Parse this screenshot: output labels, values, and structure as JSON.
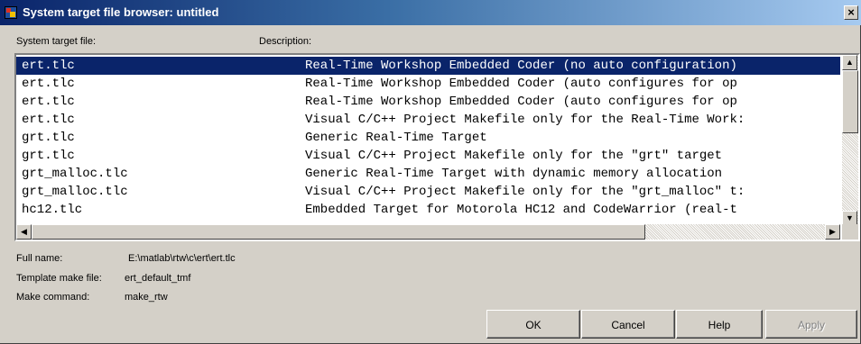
{
  "window": {
    "title": "System target file browser: untitled",
    "close_glyph": "×"
  },
  "columns": {
    "file_header": "System target file:",
    "desc_header": "Description:"
  },
  "list": {
    "selected_index": 0,
    "rows": [
      {
        "file": "ert.tlc",
        "description": "Real-Time Workshop Embedded Coder (no auto configuration)"
      },
      {
        "file": "ert.tlc",
        "description": "Real-Time Workshop Embedded Coder (auto configures for op"
      },
      {
        "file": "ert.tlc",
        "description": "Real-Time Workshop Embedded Coder (auto configures for op"
      },
      {
        "file": "ert.tlc",
        "description": "Visual C/C++ Project Makefile only for the Real-Time Work:"
      },
      {
        "file": "grt.tlc",
        "description": "Generic Real-Time Target"
      },
      {
        "file": "grt.tlc",
        "description": "Visual C/C++ Project Makefile only for the \"grt\" target"
      },
      {
        "file": "grt_malloc.tlc",
        "description": "Generic Real-Time Target with dynamic memory allocation"
      },
      {
        "file": "grt_malloc.tlc",
        "description": "Visual C/C++ Project Makefile only for the \"grt_malloc\" t:"
      },
      {
        "file": "hc12.tlc",
        "description": "Embedded Target for Motorola HC12 and CodeWarrior (real-t"
      }
    ]
  },
  "scrollbar": {
    "up_glyph": "▲",
    "down_glyph": "▼",
    "left_glyph": "◀",
    "right_glyph": "▶"
  },
  "info": {
    "full_name_label": "Full name:",
    "full_name_value": "E:\\matlab\\rtw\\c\\ert\\ert.tlc",
    "template_label": "Template make file:",
    "template_value": "ert_default_tmf",
    "make_label": "Make command:",
    "make_value": "make_rtw"
  },
  "buttons": {
    "ok": "OK",
    "cancel": "Cancel",
    "help": "Help",
    "apply": "Apply"
  },
  "colors": {
    "selection": "#0a246a",
    "dialog_bg": "#d4d0c8"
  }
}
